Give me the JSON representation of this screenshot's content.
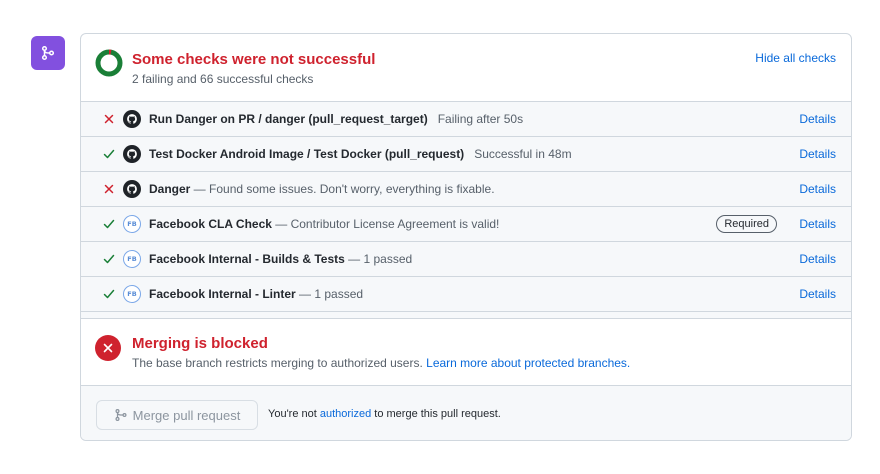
{
  "summary": {
    "title": "Some checks were not successful",
    "subtitle": "2 failing and 66 successful checks",
    "hide_label": "Hide all checks",
    "failing": 2,
    "successful": 66
  },
  "checks": [
    {
      "status": "failed",
      "app": "github",
      "name": "Run Danger on PR / danger (pull_request_target)",
      "desc": "Failing after 50s",
      "required": "",
      "details": "Details"
    },
    {
      "status": "success",
      "app": "github",
      "name": "Test Docker Android Image / Test Docker (pull_request)",
      "desc": "Successful in 48m",
      "required": "",
      "details": "Details"
    },
    {
      "status": "failed",
      "app": "github",
      "name": "Danger",
      "desc": " — Found some issues. Don't worry, everything is fixable.",
      "required": "",
      "details": "Details"
    },
    {
      "status": "success",
      "app": "facebook",
      "name": "Facebook CLA Check",
      "desc": " — Contributor License Agreement is valid!",
      "required": "Required",
      "details": "Details"
    },
    {
      "status": "success",
      "app": "facebook",
      "name": "Facebook Internal - Builds & Tests",
      "desc": " — 1 passed",
      "required": "",
      "details": "Details"
    },
    {
      "status": "success",
      "app": "facebook",
      "name": "Facebook Internal - Linter",
      "desc": " — 1 passed",
      "required": "",
      "details": "Details"
    }
  ],
  "app_avatar_fb_text": "FB",
  "blocked": {
    "title": "Merging is blocked",
    "desc": "The base branch restricts merging to authorized users. ",
    "link": "Learn more about protected branches."
  },
  "merge": {
    "button_label": "Merge pull request",
    "note_before": "You're not ",
    "note_link": "authorized",
    "note_after": " to merge this pull request."
  },
  "colors": {
    "accent": "#8250df",
    "danger": "#cf222e",
    "success": "#1a7f37",
    "link": "#0969da"
  },
  "icons": {
    "header": "git-merge-icon",
    "failed": "x-icon",
    "success": "check-icon",
    "blocked": "x-circle-icon",
    "merge_button": "git-merge-icon"
  }
}
